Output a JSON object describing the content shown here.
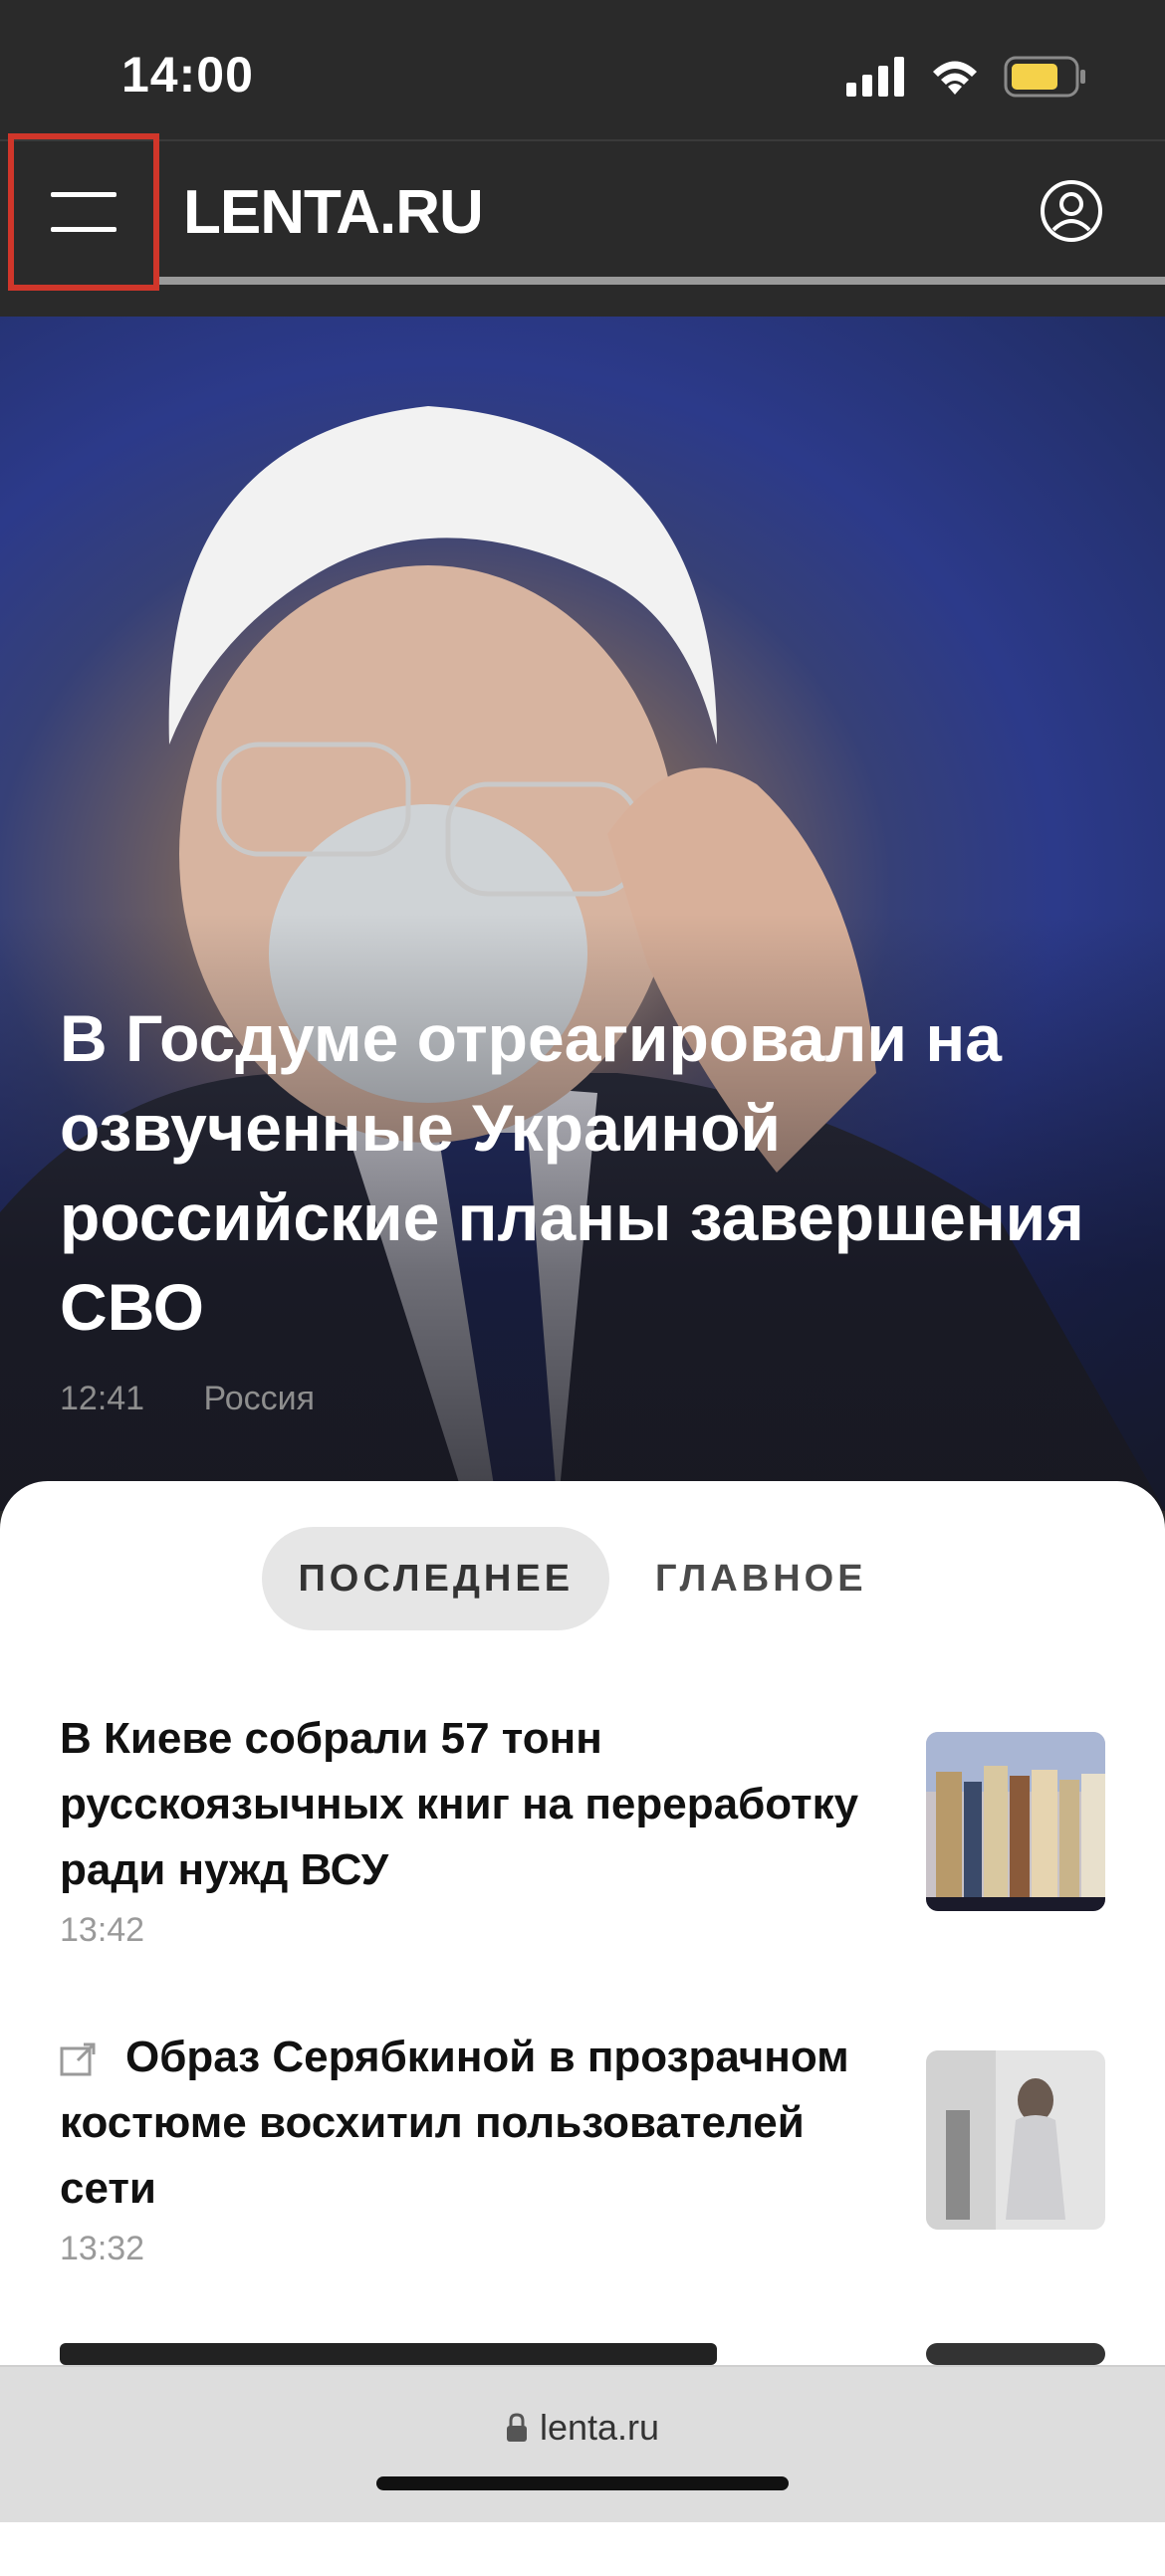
{
  "status_bar": {
    "time": "14:00",
    "icons": [
      "cellular-signal-icon",
      "wifi-icon",
      "battery-icon"
    ]
  },
  "header": {
    "logo": "LENTA.RU",
    "menu_icon": "menu-icon",
    "profile_icon": "profile-icon",
    "highlight_color": "#d0362a"
  },
  "hero": {
    "title": "В Госдуме отреагировали на озвученные Украиной российские планы завершения СВО",
    "time": "12:41",
    "category": "Россия"
  },
  "tabs": [
    {
      "label": "ПОСЛЕДНЕЕ",
      "active": true
    },
    {
      "label": "ГЛАВНОЕ",
      "active": false
    }
  ],
  "news": [
    {
      "title": "В Киеве собрали 57 тонн русскоязычных книг на переработку ради нужд ВСУ",
      "time": "13:42",
      "external": false
    },
    {
      "title": "Образ Серябкиной в прозрачном костюме восхитил пользователей сети",
      "time": "13:32",
      "external": true
    }
  ],
  "browser": {
    "url": "lenta.ru",
    "lock_icon": "lock-icon"
  }
}
